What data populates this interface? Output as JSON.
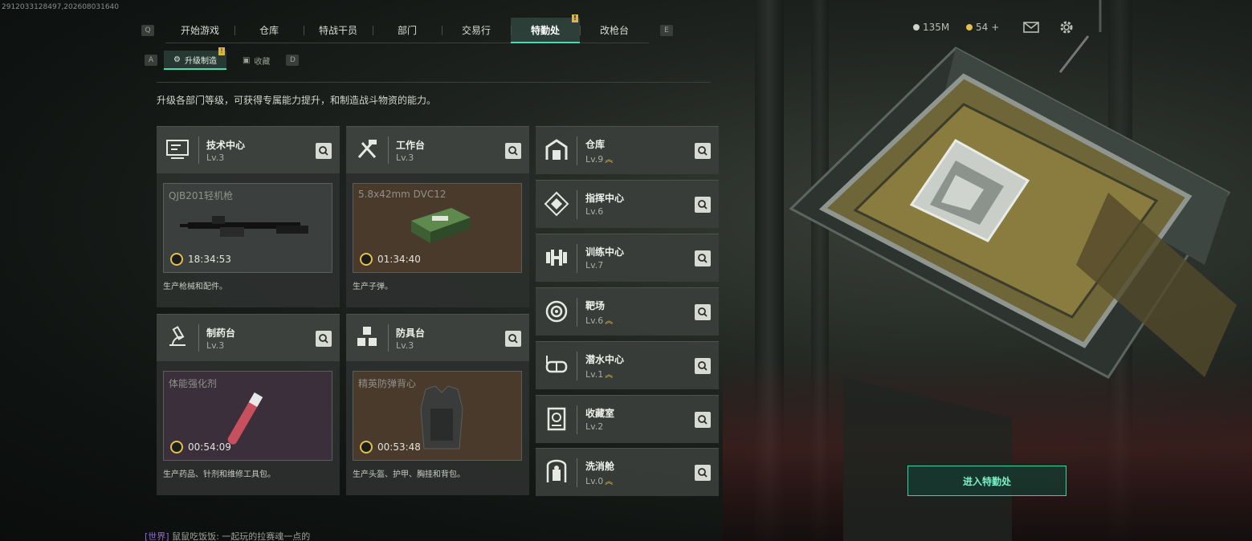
{
  "debug_id": "2912033128497,202608031640",
  "nav": {
    "left_key": "Q",
    "right_key": "E",
    "tabs": [
      {
        "label": "开始游戏"
      },
      {
        "label": "仓库"
      },
      {
        "label": "特战干员"
      },
      {
        "label": "部门"
      },
      {
        "label": "交易行"
      },
      {
        "label": "特勤处",
        "active": true,
        "badge": "!"
      },
      {
        "label": "改枪台"
      }
    ]
  },
  "subnav": {
    "left_key": "A",
    "right_key": "D",
    "tabs": [
      {
        "label": "升级制造",
        "active": true,
        "badge": "!"
      },
      {
        "label": "收藏"
      }
    ]
  },
  "currency": {
    "coins": "135M",
    "tickets": "54",
    "plus": "+"
  },
  "description": "升级各部门等级，可获得专属能力提升，和制造战斗物资的能力。",
  "production": [
    {
      "name": "技术中心",
      "level": "Lv.3",
      "item": "QJB201轻机枪",
      "timer": "18:34:53",
      "desc": "生产枪械和配件。",
      "icon": "monitor-icon"
    },
    {
      "name": "工作台",
      "level": "Lv.3",
      "item": "5.8x42mm DVC12",
      "timer": "01:34:40",
      "desc": "生产子弹。",
      "icon": "tools-icon"
    },
    {
      "name": "制药台",
      "level": "Lv.3",
      "item": "体能强化剂",
      "timer": "00:54:09",
      "desc": "生产药品、针剂和维修工具包。",
      "icon": "microscope-icon"
    },
    {
      "name": "防具台",
      "level": "Lv.3",
      "item": "精英防弹背心",
      "timer": "00:53:48",
      "desc": "生产头盔、护甲、胸挂和背包。",
      "icon": "cubes-icon"
    }
  ],
  "facilities": [
    {
      "name": "仓库",
      "level": "Lv.9",
      "upgrade": true,
      "icon": "warehouse-icon"
    },
    {
      "name": "指挥中心",
      "level": "Lv.6",
      "upgrade": false,
      "icon": "command-icon"
    },
    {
      "name": "训练中心",
      "level": "Lv.7",
      "upgrade": false,
      "icon": "dumbbell-icon"
    },
    {
      "name": "靶场",
      "level": "Lv.6",
      "upgrade": true,
      "icon": "target-icon"
    },
    {
      "name": "潜水中心",
      "level": "Lv.1",
      "upgrade": true,
      "icon": "diving-mask-icon"
    },
    {
      "name": "收藏室",
      "level": "Lv.2",
      "upgrade": false,
      "icon": "collection-icon"
    },
    {
      "name": "洗消舱",
      "level": "Lv.0",
      "upgrade": true,
      "icon": "decontamination-icon"
    }
  ],
  "upgrade_symbol": "︽",
  "enter_button": "进入特勤处",
  "chat": {
    "channel": "[世界]",
    "message": "鼠鼠吃饭饭: 一起玩的拉赛魂一点的"
  },
  "colors": {
    "accent": "#3fe0b0",
    "upgrade": "#e2c04f",
    "badge": "#d9b54a"
  }
}
